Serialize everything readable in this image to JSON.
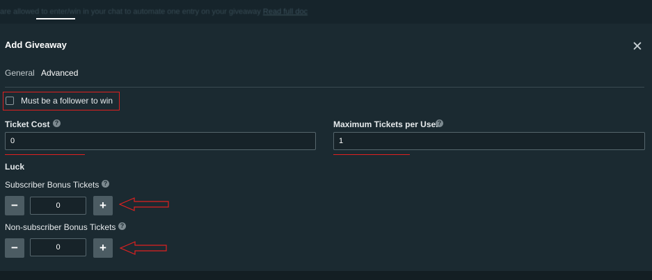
{
  "banner": {
    "text": "are allowed to enter/win in your chat to automate one entry on your giveaway",
    "link": "Read full doc"
  },
  "modal": {
    "title": "Add Giveaway",
    "close_glyph": "✕"
  },
  "tabs": [
    {
      "label": "General",
      "active": false
    },
    {
      "label": "Advanced",
      "active": true
    }
  ],
  "follower_checkbox": {
    "label": "Must be a follower to win",
    "checked": false
  },
  "ticket_cost": {
    "label": "Ticket Cost",
    "help": "?",
    "value": "0"
  },
  "max_tickets": {
    "label": "Maximum Tickets per User",
    "help": "?",
    "value": "1"
  },
  "luck": {
    "heading": "Luck",
    "subscriber_bonus": {
      "label": "Subscriber Bonus Tickets",
      "help": "?",
      "value": "0",
      "minus": "−",
      "plus": "+"
    },
    "non_subscriber_bonus": {
      "label": "Non-subscriber Bonus Tickets",
      "help": "?",
      "value": "0",
      "minus": "−",
      "plus": "+"
    }
  },
  "colors": {
    "background": "#1b2a31",
    "annotation": "#e02020",
    "button": "#4c5c63",
    "input_border": "#56666d"
  }
}
